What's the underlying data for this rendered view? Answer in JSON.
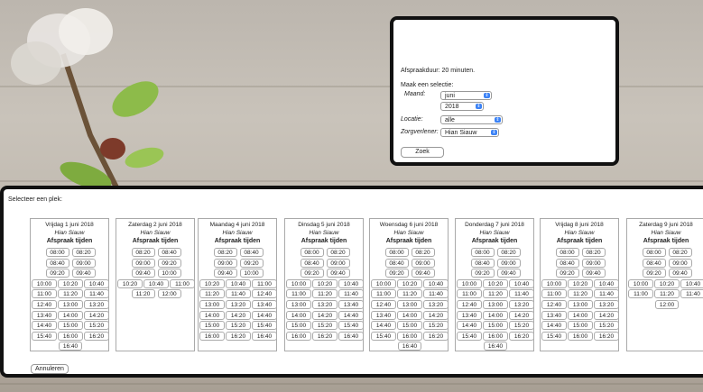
{
  "selection": {
    "duration": "Afspraakduur: 20 minuten.",
    "make_selection": "Maak een selectie:",
    "month_label": "Maand:",
    "month_value": "juni",
    "year_value": "2018",
    "location_label": "Locatie:",
    "location_value": "alle",
    "provider_label": "Zorgverlener:",
    "provider_value": "Hian Siauw",
    "search_button": "Zoek"
  },
  "slots_panel": {
    "title": "Selecteer een plek:",
    "cancel_button": "Annuleren",
    "days": [
      {
        "date": "Vrijdag 1 juni 2018",
        "provider": "Hian Siauw",
        "heading": "Afspraak tijden",
        "rows": [
          [
            "08:00",
            "08:20"
          ],
          [
            "08:40",
            "09:00"
          ],
          [
            "09:20",
            "09:40"
          ],
          [
            "10:00",
            "10:20",
            "10:40"
          ],
          [
            "11:00",
            "11:20",
            "11:40"
          ],
          [
            "12:40",
            "13:00",
            "13:20"
          ],
          [
            "13:40",
            "14:00",
            "14:20"
          ],
          [
            "14:40",
            "15:00",
            "15:20"
          ],
          [
            "15:40",
            "16:00",
            "16:20"
          ],
          [
            "16:40"
          ]
        ]
      },
      {
        "date": "Zaterdag 2 juni 2018",
        "provider": "Hian Siauw",
        "heading": "Afspraak tijden",
        "rows": [
          [
            "08:20",
            "08:40"
          ],
          [
            "09:00",
            "09:20"
          ],
          [
            "09:40",
            "10:00"
          ],
          [
            "10:20",
            "10:40",
            "11:00"
          ],
          [
            "11:20",
            "12:00"
          ]
        ]
      },
      {
        "date": "Maandag 4 juni 2018",
        "provider": "Hian Siauw",
        "heading": "Afspraak tijden",
        "rows": [
          [
            "08:20",
            "08:40"
          ],
          [
            "09:00",
            "09:20"
          ],
          [
            "09:40",
            "10:00"
          ],
          [
            "10:20",
            "10:40",
            "11:00"
          ],
          [
            "11:20",
            "11:40",
            "12:40"
          ],
          [
            "13:00",
            "13:20",
            "13:40"
          ],
          [
            "14:00",
            "14:20",
            "14:40"
          ],
          [
            "15:00",
            "15:20",
            "15:40"
          ],
          [
            "16:00",
            "16:20",
            "16:40"
          ]
        ]
      },
      {
        "date": "Dinsdag 5 juni 2018",
        "provider": "Hian Siauw",
        "heading": "Afspraak tijden",
        "rows": [
          [
            "08:00",
            "08:20"
          ],
          [
            "08:40",
            "09:00"
          ],
          [
            "09:20",
            "09:40"
          ],
          [
            "10:00",
            "10:20",
            "10:40"
          ],
          [
            "11:00",
            "11:20",
            "11:40"
          ],
          [
            "13:00",
            "13:20",
            "13:40"
          ],
          [
            "14:00",
            "14:20",
            "14:40"
          ],
          [
            "15:00",
            "15:20",
            "15:40"
          ],
          [
            "16:00",
            "16:20",
            "16:40"
          ]
        ]
      },
      {
        "date": "Woensdag 6 juni 2018",
        "provider": "Hian Siauw",
        "heading": "Afspraak tijden",
        "rows": [
          [
            "08:00",
            "08:20"
          ],
          [
            "08:40",
            "09:00"
          ],
          [
            "09:20",
            "09:40"
          ],
          [
            "10:00",
            "10:20",
            "10:40"
          ],
          [
            "11:00",
            "11:20",
            "11:40"
          ],
          [
            "12:40",
            "13:00",
            "13:20"
          ],
          [
            "13:40",
            "14:00",
            "14:20"
          ],
          [
            "14:40",
            "15:00",
            "15:20"
          ],
          [
            "15:40",
            "16:00",
            "16:20"
          ],
          [
            "16:40"
          ]
        ]
      },
      {
        "date": "Donderdag 7 juni 2018",
        "provider": "Hian Siauw",
        "heading": "Afspraak tijden",
        "rows": [
          [
            "08:00",
            "08:20"
          ],
          [
            "08:40",
            "09:00"
          ],
          [
            "09:20",
            "09:40"
          ],
          [
            "10:00",
            "10:20",
            "10:40"
          ],
          [
            "11:00",
            "11:20",
            "11:40"
          ],
          [
            "12:40",
            "13:00",
            "13:20"
          ],
          [
            "13:40",
            "14:00",
            "14:20"
          ],
          [
            "14:40",
            "15:00",
            "15:20"
          ],
          [
            "15:40",
            "16:00",
            "16:20"
          ],
          [
            "16:40"
          ]
        ]
      },
      {
        "date": "Vrijdag 8 juni 2018",
        "provider": "Hian Siauw",
        "heading": "Afspraak tijden",
        "rows": [
          [
            "08:00",
            "08:20"
          ],
          [
            "08:40",
            "09:00"
          ],
          [
            "09:20",
            "09:40"
          ],
          [
            "10:00",
            "10:20",
            "10:40"
          ],
          [
            "11:00",
            "11:20",
            "11:40"
          ],
          [
            "12:40",
            "13:00",
            "13:20"
          ],
          [
            "13:40",
            "14:00",
            "14:20"
          ],
          [
            "14:40",
            "15:00",
            "15:20"
          ],
          [
            "15:40",
            "16:00",
            "16:20"
          ]
        ]
      },
      {
        "date": "Zaterdag 9 juni 2018",
        "provider": "Hian Siauw",
        "heading": "Afspraak tijden",
        "rows": [
          [
            "08:00",
            "08:20"
          ],
          [
            "08:40",
            "09:00"
          ],
          [
            "09:20",
            "09:40"
          ],
          [
            "10:00",
            "10:20",
            "10:40"
          ],
          [
            "11:00",
            "11:20",
            "11:40"
          ],
          [
            "12:00"
          ]
        ]
      }
    ]
  },
  "colors": {
    "accent": "#3b82f6",
    "panel_border": "#111111"
  }
}
